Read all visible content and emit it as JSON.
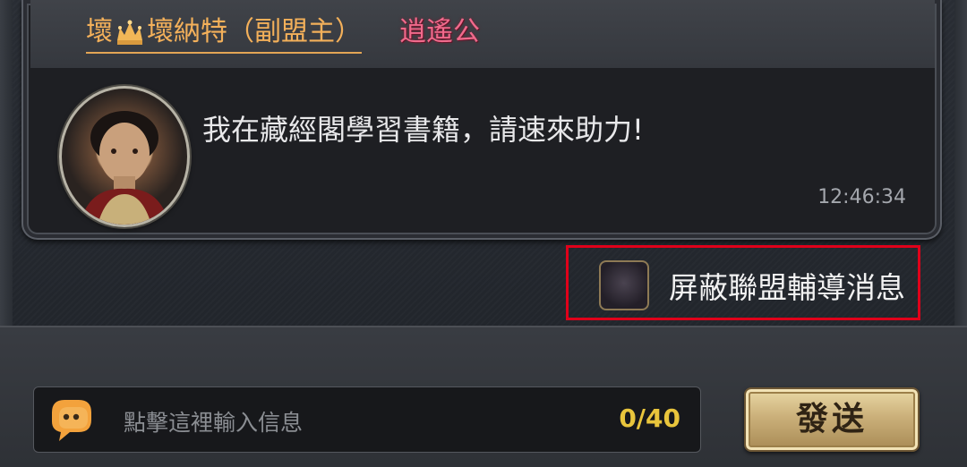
{
  "message": {
    "sender_prefix": "壞",
    "sender_name": "壞納特（副盟主）",
    "title_badge": "逍遙公",
    "text": "我在藏經閣學習書籍，請速來助力!",
    "time": "12:46:34"
  },
  "block_toggle": {
    "label": "屏蔽聯盟輔導消息",
    "checked": false
  },
  "composer": {
    "placeholder": "點擊這裡輸入信息",
    "count": "0/40",
    "send_label": "發送"
  },
  "icons": {
    "crown": "crown-icon",
    "chat": "speech-bubble-icon"
  },
  "colors": {
    "sender": "#f3b05a",
    "title_badge": "#f06a8c",
    "count": "#e9c53c",
    "highlight_border": "#e0001a"
  }
}
